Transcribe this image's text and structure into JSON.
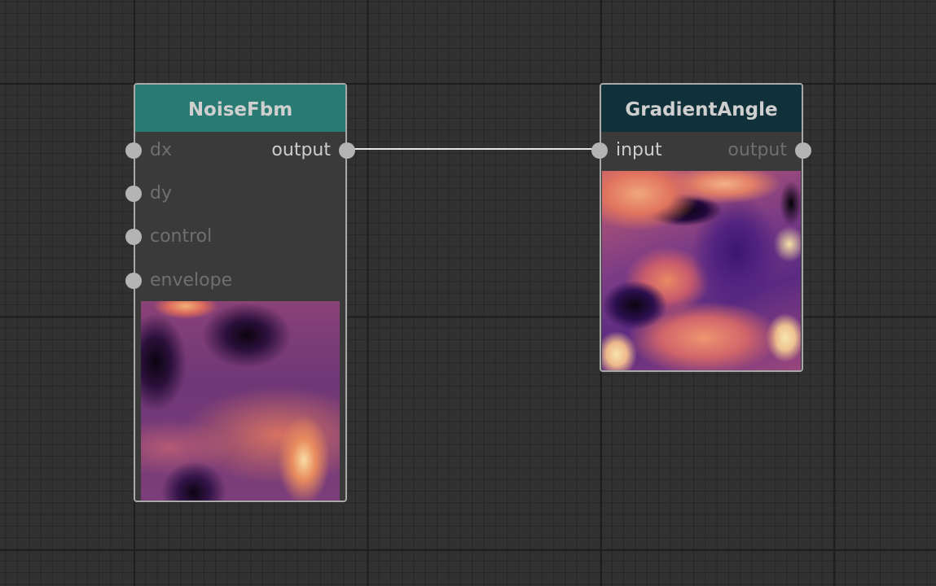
{
  "nodes": {
    "noise_fbm": {
      "title": "NoiseFbm",
      "header_color": "#287a72",
      "inputs": [
        "dx",
        "dy",
        "control",
        "envelope"
      ],
      "output": "output"
    },
    "gradient_angle": {
      "title": "GradientAngle",
      "header_color": "#11313a",
      "input": "input",
      "output": "output"
    }
  },
  "connections": [
    {
      "from": "NoiseFbm.output",
      "to": "GradientAngle.input"
    }
  ],
  "colors": {
    "canvas_background": "#313131",
    "node_body": "#3a3a3a",
    "node_border": "#a9a9a9",
    "port": "#b4b4b4",
    "wire": "#e6e6e6",
    "connected_label": "#cdcdcd",
    "unconnected_label": "#6f6f6f"
  }
}
